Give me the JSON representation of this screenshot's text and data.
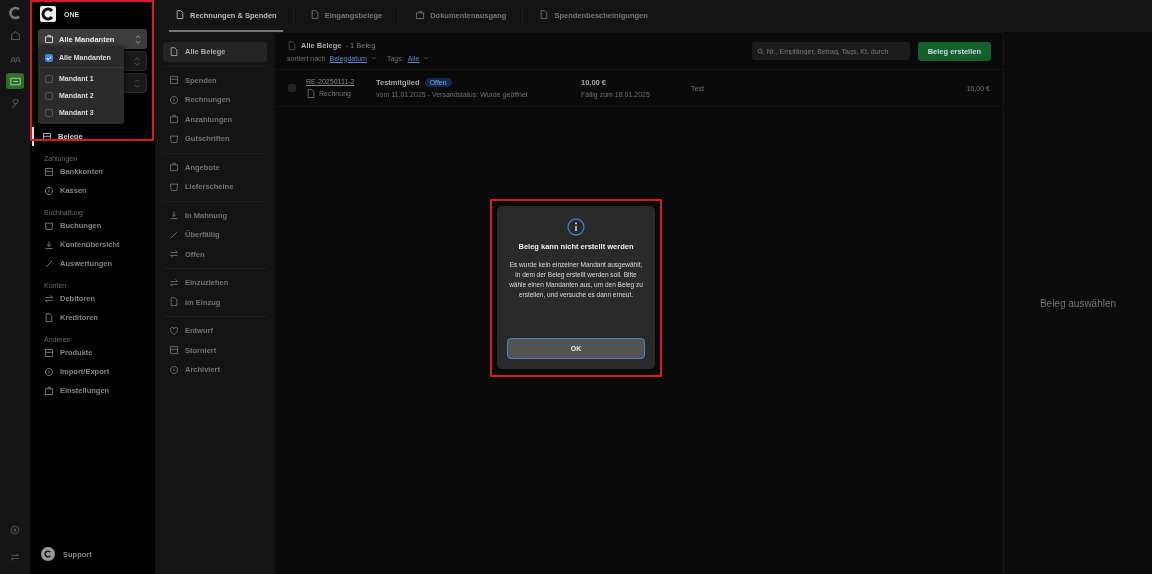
{
  "rail": {
    "items": [
      {
        "selected": false
      },
      {
        "selected": false
      },
      {
        "selected": true
      },
      {
        "selected": false
      }
    ]
  },
  "sidebar": {
    "brand": "ONE",
    "client_select": {
      "value": "Alle Mandanten",
      "expanded": true
    },
    "client_menu": [
      {
        "label": "Alle Mandanten",
        "checked": true
      },
      {
        "label": "Mandant 1",
        "checked": false
      },
      {
        "label": "Mandant 2",
        "checked": false
      },
      {
        "label": "Mandant 3",
        "checked": false
      }
    ],
    "nav": [
      {
        "label": "Belege",
        "selected": true
      }
    ],
    "sections": [
      {
        "title": "Zahlungen",
        "items": [
          {
            "label": "Bankkonten",
            "selected": false
          },
          {
            "label": "Kassen",
            "selected": false
          }
        ]
      },
      {
        "title": "Buchhaltung",
        "items": [
          {
            "label": "Buchungen",
            "selected": false
          },
          {
            "label": "Kontenübersicht",
            "selected": false
          },
          {
            "label": "Auswertungen",
            "selected": false
          }
        ]
      },
      {
        "title": "Konten",
        "items": [
          {
            "label": "Debitoren",
            "selected": false
          },
          {
            "label": "Kreditoren",
            "selected": false
          }
        ]
      },
      {
        "title": "Anderes",
        "items": [
          {
            "label": "Produkte",
            "selected": false
          },
          {
            "label": "Import/Export",
            "selected": false
          },
          {
            "label": "Einstellungen",
            "selected": false
          }
        ]
      }
    ],
    "support": "Support"
  },
  "tabs": [
    {
      "label": "Rechnungen & Spenden",
      "selected": true
    },
    {
      "label": "Eingangsbelege",
      "selected": false
    },
    {
      "label": "Dokumentenausgang",
      "selected": false
    },
    {
      "label": "Spendenbescheinigungen",
      "selected": false
    }
  ],
  "filters": [
    [
      {
        "label": "Alle Belege",
        "selected": true
      }
    ],
    [
      {
        "label": "Spenden",
        "selected": false
      },
      {
        "label": "Rechnungen",
        "selected": false
      },
      {
        "label": "Anzahlungen",
        "selected": false
      },
      {
        "label": "Gutschriften",
        "selected": false
      }
    ],
    [
      {
        "label": "Angebote",
        "selected": false
      },
      {
        "label": "Lieferscheine",
        "selected": false
      }
    ],
    [
      {
        "label": "In Mahnung",
        "selected": false
      },
      {
        "label": "Überfällig",
        "selected": false
      },
      {
        "label": "Offen",
        "selected": false
      }
    ],
    [
      {
        "label": "Einzuziehen",
        "selected": false
      },
      {
        "label": "Im Einzug",
        "selected": false
      }
    ],
    [
      {
        "label": "Entwurf",
        "selected": false
      },
      {
        "label": "Storniert",
        "selected": false
      },
      {
        "label": "Archiviert",
        "selected": false
      }
    ]
  ],
  "list": {
    "title": "Alle Belege",
    "count": "- 1 Beleg",
    "sort_label": "sortiert nach",
    "sort_value": "Belegdatum",
    "tags_label": "Tags:",
    "tags_value": "Alle",
    "search": {
      "placeholder": "Nr., Empfänger, Betrag, Tags, Kt. durch"
    },
    "create_button": "Beleg erstellen",
    "rows": [
      {
        "number": "RE-20250111-2",
        "type": "Rechnung",
        "recipient": "Testmitglied",
        "status": "Offen",
        "meta": "vom 11.01.2025 - Versandstatus: Wurde geöffnet",
        "amount": "10,00 €",
        "due": "Fällig zum 18.01.2025",
        "column_5": "Test",
        "total": "10,00 €",
        "checked": false
      }
    ]
  },
  "detail": {
    "empty_text": "Beleg auswählen"
  },
  "dialog": {
    "title": "Beleg kann nicht erstellt werden",
    "message": "Es wurde kein einzelner Mandant ausgewählt, in dem der Beleg erstellt werden soll. Bitte wähle einen Mandanten aus, um den Beleg zu erstellen, und versuche es dann erneut.",
    "button": "OK"
  }
}
